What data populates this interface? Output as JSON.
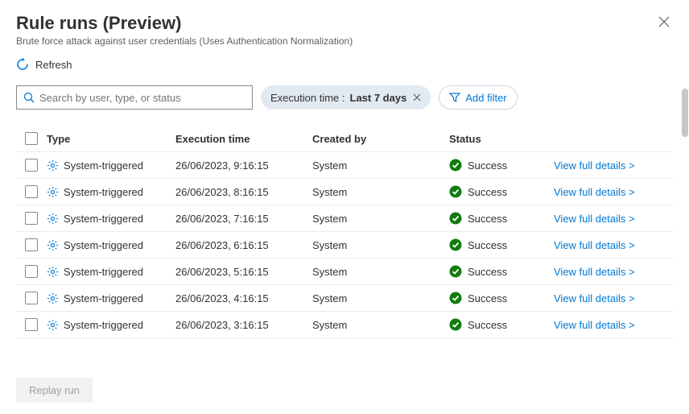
{
  "header": {
    "title": "Rule runs (Preview)",
    "subtitle": "Brute force attack against user credentials (Uses Authentication Normalization)"
  },
  "toolbar": {
    "refresh_label": "Refresh"
  },
  "search": {
    "placeholder": "Search by user, type, or status"
  },
  "filters": {
    "time_label": "Execution time : ",
    "time_value": "Last 7 days",
    "add_label": "Add filter"
  },
  "columns": {
    "type": "Type",
    "execution_time": "Execution time",
    "created_by": "Created by",
    "status": "Status"
  },
  "link_label": "View full details  >",
  "rows": [
    {
      "type": "System-triggered",
      "time": "26/06/2023, 9:16:15",
      "by": "System",
      "status": "Success"
    },
    {
      "type": "System-triggered",
      "time": "26/06/2023, 8:16:15",
      "by": "System",
      "status": "Success"
    },
    {
      "type": "System-triggered",
      "time": "26/06/2023, 7:16:15",
      "by": "System",
      "status": "Success"
    },
    {
      "type": "System-triggered",
      "time": "26/06/2023, 6:16:15",
      "by": "System",
      "status": "Success"
    },
    {
      "type": "System-triggered",
      "time": "26/06/2023, 5:16:15",
      "by": "System",
      "status": "Success"
    },
    {
      "type": "System-triggered",
      "time": "26/06/2023, 4:16:15",
      "by": "System",
      "status": "Success"
    },
    {
      "type": "System-triggered",
      "time": "26/06/2023, 3:16:15",
      "by": "System",
      "status": "Success"
    }
  ],
  "footer": {
    "replay_label": "Replay run"
  }
}
